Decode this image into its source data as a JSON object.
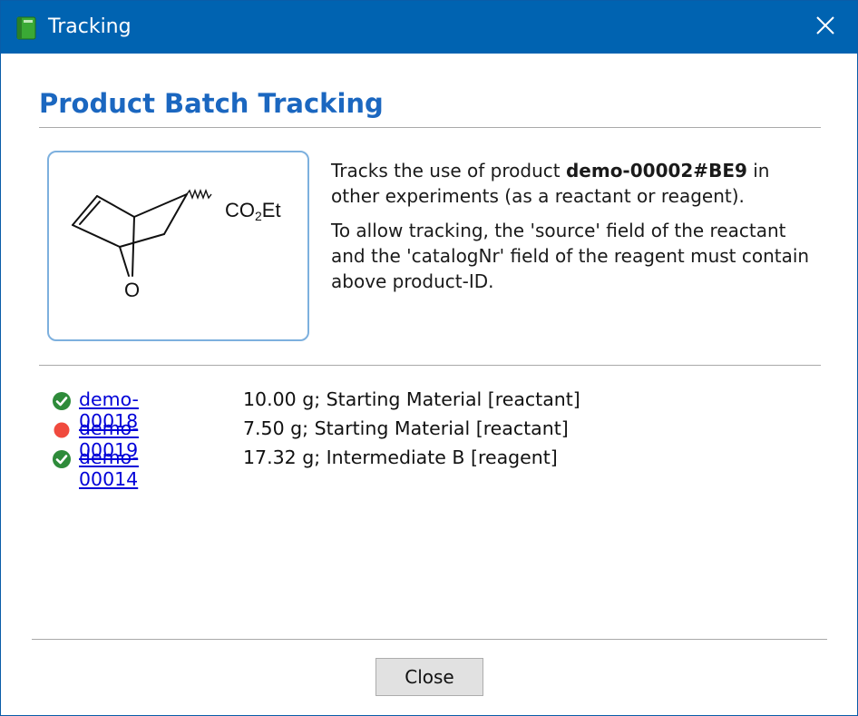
{
  "window": {
    "title": "Tracking",
    "app_icon": "green-book-icon",
    "close_icon": "close-icon"
  },
  "heading": "Product Batch Tracking",
  "structure": {
    "group_label_main": "CO",
    "group_label_sub": "2",
    "group_label_end": "Et",
    "oxygen_label": "O"
  },
  "description": {
    "line1_prefix": "Tracks the use of product ",
    "product_id": "demo-00002#BE9",
    "line1_suffix": " in other experiments (as a reactant or reagent).",
    "paragraph2": "To allow tracking, the 'source' field of the reactant and the 'catalogNr' field of the reagent must contain above product-ID."
  },
  "items": [
    {
      "status": "ok",
      "status_icon": "check-circle-icon",
      "id": "demo-00018",
      "info": "10.00 g; Starting Material [reactant]"
    },
    {
      "status": "error",
      "status_icon": "red-dot-icon",
      "id": "demo-00019",
      "info": "7.50 g; Starting Material [reactant]"
    },
    {
      "status": "ok",
      "status_icon": "check-circle-icon",
      "id": "demo-00014",
      "info": "17.32 g; Intermediate B [reagent]"
    }
  ],
  "footer": {
    "close_label": "Close"
  },
  "colors": {
    "titlebar": "#0063b1",
    "heading": "#1b67c0",
    "link": "#0000d8",
    "ok": "#2e8b3a",
    "error": "#f04a3e",
    "structure_border": "#7db0de"
  }
}
